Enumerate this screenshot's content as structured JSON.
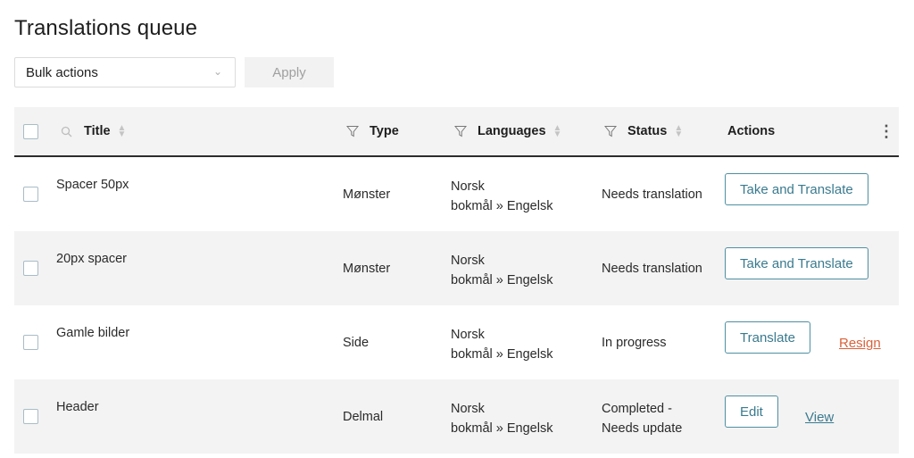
{
  "page": {
    "title": "Translations queue"
  },
  "toolbar": {
    "bulk_actions": "Bulk actions",
    "apply": "Apply"
  },
  "columns": {
    "title": "Title",
    "type": "Type",
    "languages": "Languages",
    "status": "Status",
    "actions": "Actions"
  },
  "colors": {
    "accent": "#3a7a8f",
    "danger": "#d9623b"
  },
  "rows": [
    {
      "title": "Spacer 50px",
      "type": "Mønster",
      "lang1": "Norsk",
      "lang2": "bokmål » Engelsk",
      "status1": "Needs translation",
      "status2": "",
      "primary": "Take and Translate",
      "secondary": ""
    },
    {
      "title": "20px spacer",
      "type": "Mønster",
      "lang1": "Norsk",
      "lang2": "bokmål » Engelsk",
      "status1": "Needs translation",
      "status2": "",
      "primary": "Take and Translate",
      "secondary": ""
    },
    {
      "title": "Gamle bilder",
      "type": "Side",
      "lang1": "Norsk",
      "lang2": "bokmål » Engelsk",
      "status1": "In progress",
      "status2": "",
      "primary": "Translate",
      "secondary": "Resign"
    },
    {
      "title": "Header",
      "type": "Delmal",
      "lang1": "Norsk",
      "lang2": "bokmål » Engelsk",
      "status1": "Completed -",
      "status2": "Needs update",
      "primary": "Edit",
      "secondary": "View"
    }
  ]
}
